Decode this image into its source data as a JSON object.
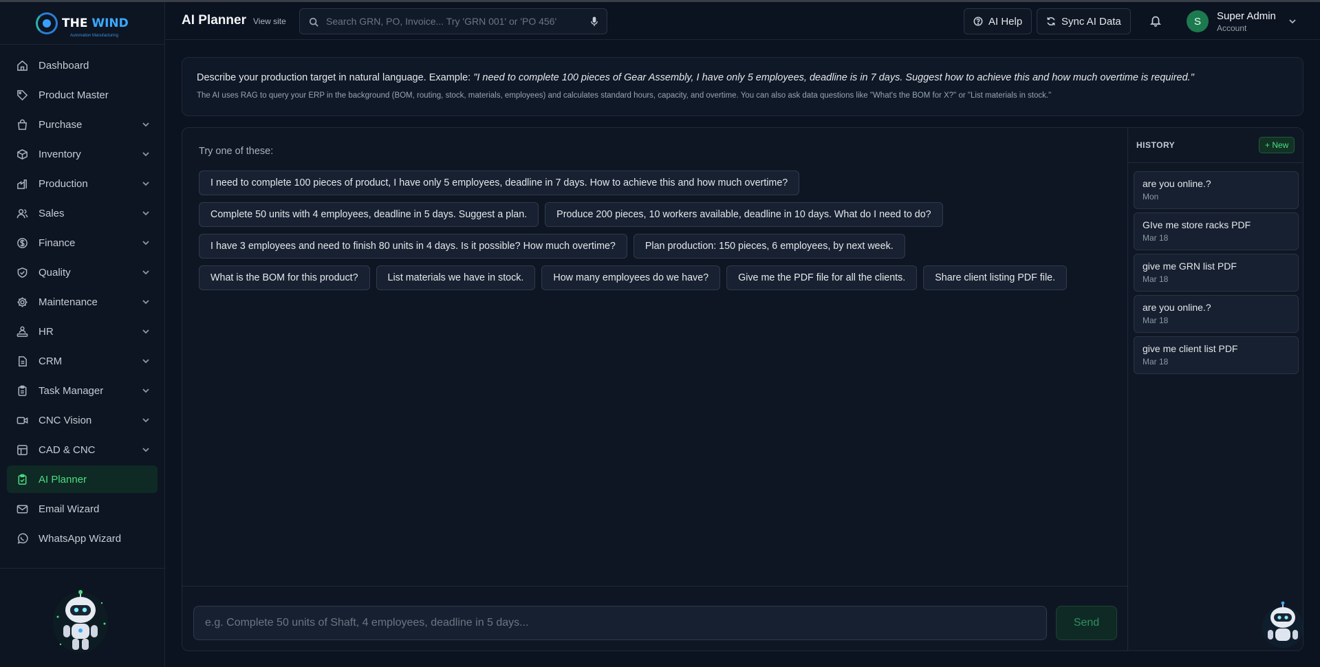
{
  "brand": {
    "name_part1": "THE",
    "name_part2": "WIND",
    "tagline": "Automation Manufacturing"
  },
  "sidebar": {
    "items": [
      {
        "label": "Dashboard",
        "icon": "home-icon",
        "expandable": false,
        "active": false
      },
      {
        "label": "Product Master",
        "icon": "tag-icon",
        "expandable": false,
        "active": false
      },
      {
        "label": "Purchase",
        "icon": "bag-icon",
        "expandable": true,
        "active": false
      },
      {
        "label": "Inventory",
        "icon": "box-icon",
        "expandable": true,
        "active": false
      },
      {
        "label": "Production",
        "icon": "factory-icon",
        "expandable": true,
        "active": false
      },
      {
        "label": "Sales",
        "icon": "users-icon",
        "expandable": true,
        "active": false
      },
      {
        "label": "Finance",
        "icon": "dollar-icon",
        "expandable": true,
        "active": false
      },
      {
        "label": "Quality",
        "icon": "shield-check-icon",
        "expandable": true,
        "active": false
      },
      {
        "label": "Maintenance",
        "icon": "gear-icon",
        "expandable": true,
        "active": false
      },
      {
        "label": "HR",
        "icon": "org-chart-icon",
        "expandable": true,
        "active": false
      },
      {
        "label": "CRM",
        "icon": "document-icon",
        "expandable": true,
        "active": false
      },
      {
        "label": "Task Manager",
        "icon": "clipboard-icon",
        "expandable": true,
        "active": false
      },
      {
        "label": "CNC Vision",
        "icon": "video-icon",
        "expandable": true,
        "active": false
      },
      {
        "label": "CAD & CNC",
        "icon": "layers-icon",
        "expandable": true,
        "active": false
      },
      {
        "label": "AI Planner",
        "icon": "clipboard-check-icon",
        "expandable": false,
        "active": true
      },
      {
        "label": "Email Wizard",
        "icon": "mail-icon",
        "expandable": false,
        "active": false
      },
      {
        "label": "WhatsApp Wizard",
        "icon": "whatsapp-icon",
        "expandable": false,
        "active": false
      }
    ]
  },
  "header": {
    "title": "AI Planner",
    "view_site": "View site",
    "search_placeholder": "Search GRN, PO, Invoice... Try 'GRN 001' or 'PO 456'",
    "ai_help": "AI Help",
    "sync": "Sync AI Data",
    "user": {
      "initial": "S",
      "name": "Super Admin",
      "role": "Account"
    }
  },
  "banner": {
    "intro": "Describe your production target in natural language. Example: ",
    "example": "\"I need to complete 100 pieces of Gear Assembly, I have only 5 employees, deadline is in 7 days. Suggest how to achieve this and how much overtime is required.\"",
    "detail": "The AI uses RAG to query your ERP in the background (BOM, routing, stock, materials, employees) and calculates standard hours, capacity, and overtime. You can also ask data questions like \"What's the BOM for X?\" or \"List materials in stock.\""
  },
  "chat": {
    "try_label": "Try one of these:",
    "suggestions": [
      [
        "I need to complete 100 pieces of product, I have only 5 employees, deadline in 7 days. How to achieve this and how much overtime?"
      ],
      [
        "Complete 50 units with 4 employees, deadline in 5 days. Suggest a plan.",
        "Produce 200 pieces, 10 workers available, deadline in 10 days. What do I need to do?"
      ],
      [
        "I have 3 employees and need to finish 80 units in 4 days. Is it possible? How much overtime?",
        "Plan production: 150 pieces, 6 employees, by next week."
      ],
      [
        "What is the BOM for this product?",
        "List materials we have in stock.",
        "How many employees do we have?",
        "Give me the PDF file for all the clients.",
        "Share client listing PDF file."
      ]
    ],
    "input_placeholder": "e.g. Complete 50 units of Shaft, 4 employees, deadline in 5 days...",
    "send_label": "Send"
  },
  "history": {
    "title": "HISTORY",
    "new_label": "+ New",
    "items": [
      {
        "title": "are you online.?",
        "date": "Mon"
      },
      {
        "title": "GIve me store racks PDF",
        "date": "Mar 18"
      },
      {
        "title": "give me GRN list PDF",
        "date": "Mar 18"
      },
      {
        "title": "are you online.?",
        "date": "Mar 18"
      },
      {
        "title": "give me client list PDF",
        "date": "Mar 18"
      }
    ]
  },
  "colors": {
    "accent": "#4ade80",
    "background": "#0b1220",
    "panel": "#0e1624"
  }
}
